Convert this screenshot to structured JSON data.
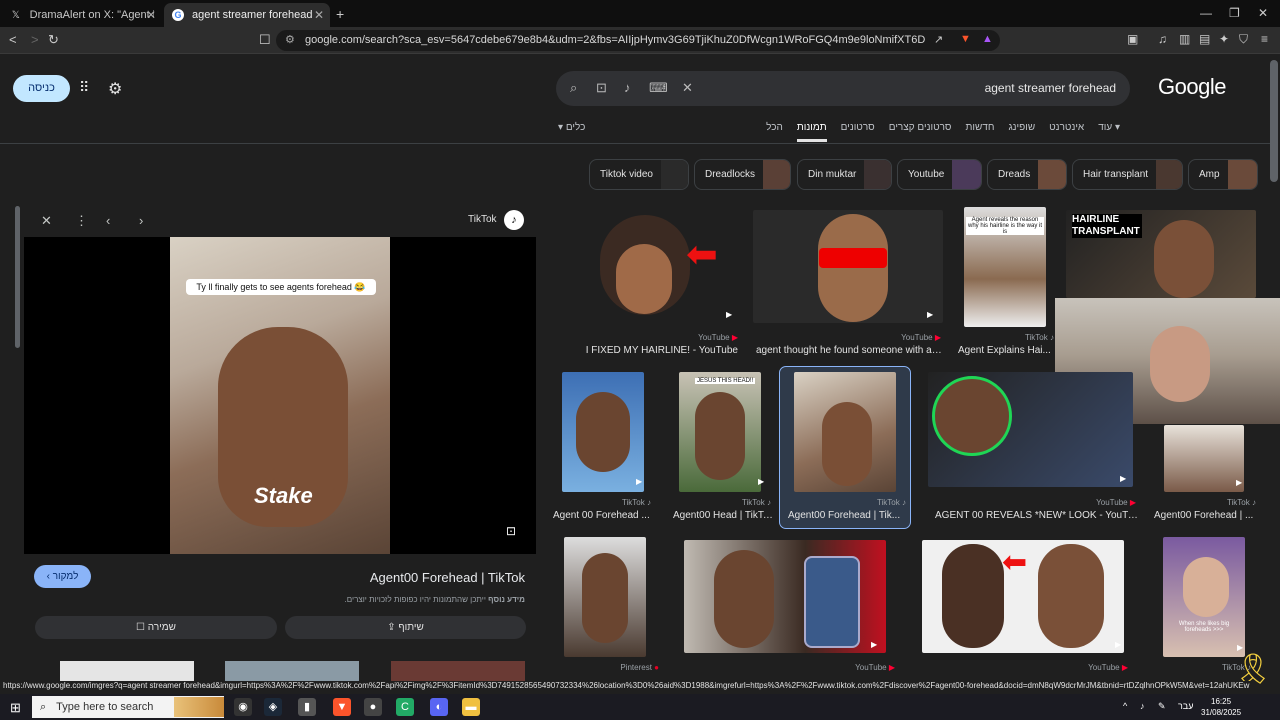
{
  "browser": {
    "tabs": [
      {
        "label": "DramaAlert on X: \"Agent had his han",
        "icon": "x-logo-icon"
      },
      {
        "label": "agent streamer forehead - ‏חיפוש ב",
        "icon": "google-g-icon"
      }
    ],
    "url": "google.com/search?sca_esv=5647cdebe679e8b4&udm=2&fbs=AIIjpHymv3G69TjiKhuZ0DfWcgn1WRoFGQ4m9e9loNmifXT6Ddfj3LwlSiOWYwPPKR8_..."
  },
  "google": {
    "signin_label": "כניסה",
    "query": "agent streamer forehead",
    "logo": "Google",
    "nav_tabs": [
      "הכל",
      "תמונות",
      "סרטונים",
      "סרטונים קצרים",
      "חדשות",
      "שופינג",
      "אינטרנט",
      "עוד"
    ],
    "active_tab": "תמונות",
    "tools_label": "כלים",
    "chips": [
      "Tiktok video",
      "Dreadlocks",
      "Din muktar",
      "Youtube",
      "Dreads",
      "Hair transplant",
      "Amp"
    ]
  },
  "panel": {
    "source": "TikTok",
    "caption": "Ty ll finally gets to see agents forehead 😂",
    "overlay_text": "Stake",
    "visit_label": "למקור",
    "title": "Agent00 Forehead | TikTok",
    "notice_bold": "מידע נוסף",
    "notice": "ייתכן שהתמונות יהיו כפופות לזכויות יוצרים.",
    "share_label": "שיתוף",
    "save_label": "שמירה"
  },
  "results": [
    {
      "source": "YouTube",
      "title": "I FIXED MY HAIRLINE! - YouTube"
    },
    {
      "source": "YouTube",
      "title": "agent thought he found someone with a ..."
    },
    {
      "source": "TikTok",
      "title": "Agent Explains Hai..."
    },
    {
      "source": "",
      "title": ""
    },
    {
      "source": "TikTok",
      "title": "Agent 00 Forehead ..."
    },
    {
      "source": "TikTok",
      "title": "Agent00 Head | TikTok"
    },
    {
      "source": "TikTok",
      "title": "Agent00 Forehead | Tik..."
    },
    {
      "source": "YouTube",
      "title": "AGENT 00 REVEALS *NEW* LOOK - YouTube"
    },
    {
      "source": "TikTok",
      "title": "Agent00 Forehead | ..."
    },
    {
      "source": "Pinterest",
      "title": ""
    },
    {
      "source": "YouTube",
      "title": ""
    },
    {
      "source": "",
      "title": ""
    },
    {
      "source": "YouTube",
      "title": ""
    },
    {
      "source": "TikTok",
      "title": ""
    }
  ],
  "thumb_texts": {
    "hairline": "HAIRLINE TRANSPLANT",
    "agent_reveals": "Agent reveals the reason why his hairline is the way it is",
    "jesus": "JESUS THIS HEAD!!",
    "big_foreheads": "When she likes big foreheads >>>"
  },
  "status_url": "https://www.google.com/imgres?q=agent streamer forehead&imgurl=https%3A%2F%2Fwww.tiktok.com%2Fapi%2Fimg%2F%3FitemId%3D7491528565490732334%26location%3D0%26aid%3D1988&imgrefurl=https%3A%2F%2Fwww.tiktok.com%2Fdiscover%2Fagent00-forehead&docid=dmN8qW9dcrMrJM&tbnid=rtDZqlhnOPkW5M&vet=12ahUKEw",
  "taskbar": {
    "search_placeholder": "Type here to search",
    "lang": "עבר",
    "time": "16:25",
    "date": "31/08/2025"
  },
  "colors": {
    "accent": "#8ab4f8",
    "signin_bg": "#c2e7ff",
    "youtube": "#ff0033"
  }
}
